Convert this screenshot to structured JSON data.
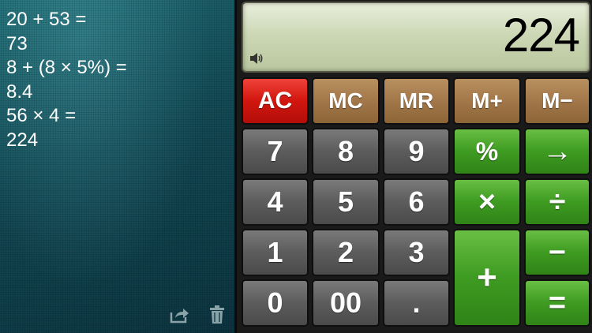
{
  "history": {
    "lines": [
      "20 + 53 =",
      "73",
      "8 + (8 × 5%) =",
      "8.4",
      "56 × 4 =",
      "224"
    ]
  },
  "display": {
    "value": "224"
  },
  "keys": {
    "ac": "AC",
    "mc": "MC",
    "mr": "MR",
    "mplus": "M+",
    "mminus": "M−",
    "seven": "7",
    "eight": "8",
    "nine": "9",
    "percent": "%",
    "arrow": "→",
    "four": "4",
    "five": "5",
    "six": "6",
    "multiply": "×",
    "divide": "÷",
    "one": "1",
    "two": "2",
    "three": "3",
    "plus": "+",
    "minus": "−",
    "zero": "0",
    "double_zero": "00",
    "decimal": ".",
    "equals": "="
  },
  "icons": {
    "share": "share-icon",
    "trash": "trash-icon",
    "speaker": "speaker-icon"
  },
  "colors": {
    "red": "#d2170f",
    "brown": "#a3784a",
    "gray": "#5d5d5d",
    "green": "#3f9c22"
  }
}
